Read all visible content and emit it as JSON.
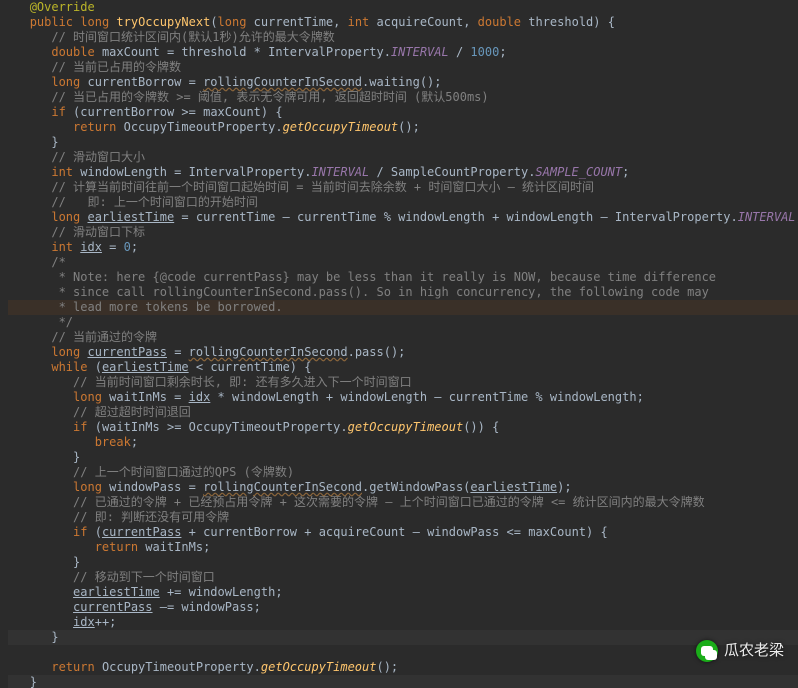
{
  "watermark": "瓜农老梁",
  "lines": [
    {
      "indent": 1,
      "parts": [
        {
          "t": "@Override",
          "c": "ann"
        }
      ]
    },
    {
      "indent": 1,
      "parts": [
        {
          "t": "public ",
          "c": "mod"
        },
        {
          "t": "long ",
          "c": "type"
        },
        {
          "t": "tryOccupyNext",
          "c": "methodDef"
        },
        {
          "t": "(",
          "c": "p"
        },
        {
          "t": "long ",
          "c": "type"
        },
        {
          "t": "currentTime",
          "c": "decl"
        },
        {
          "t": ", ",
          "c": "p"
        },
        {
          "t": "int ",
          "c": "type"
        },
        {
          "t": "acquireCount",
          "c": "decl"
        },
        {
          "t": ", ",
          "c": "p"
        },
        {
          "t": "double ",
          "c": "type"
        },
        {
          "t": "threshold",
          "c": "decl"
        },
        {
          "t": ") {",
          "c": "brace"
        }
      ]
    },
    {
      "indent": 2,
      "parts": [
        {
          "t": "// 时间窗口统计区间内(默认1秒)允许的最大令牌数",
          "c": "cmt"
        }
      ]
    },
    {
      "indent": 2,
      "parts": [
        {
          "t": "double ",
          "c": "type"
        },
        {
          "t": "maxCount = threshold * IntervalProperty.",
          "c": "var"
        },
        {
          "t": "INTERVAL",
          "c": "const"
        },
        {
          "t": " / ",
          "c": "p"
        },
        {
          "t": "1000",
          "c": "num"
        },
        {
          "t": ";",
          "c": "p"
        }
      ]
    },
    {
      "indent": 2,
      "parts": [
        {
          "t": "// 当前已占用的令牌数",
          "c": "cmt"
        }
      ]
    },
    {
      "indent": 2,
      "parts": [
        {
          "t": "long ",
          "c": "type"
        },
        {
          "t": "currentBorrow = ",
          "c": "var"
        },
        {
          "t": "rollingCounterInSecond",
          "c": "warn"
        },
        {
          "t": ".waiting();",
          "c": "p"
        }
      ]
    },
    {
      "indent": 2,
      "parts": [
        {
          "t": "// 当已占用的令牌数 >= 阈值, 表示无令牌可用, 返回超时时间 (默认500ms)",
          "c": "cmt"
        }
      ]
    },
    {
      "indent": 2,
      "parts": [
        {
          "t": "if ",
          "c": "kw"
        },
        {
          "t": "(currentBorrow >= maxCount) {",
          "c": "p"
        }
      ]
    },
    {
      "indent": 3,
      "parts": [
        {
          "t": "return ",
          "c": "kw"
        },
        {
          "t": "OccupyTimeoutProperty.",
          "c": "var"
        },
        {
          "t": "getOccupyTimeout",
          "c": "italic"
        },
        {
          "t": "();",
          "c": "p"
        }
      ]
    },
    {
      "indent": 2,
      "parts": [
        {
          "t": "}",
          "c": "brace"
        }
      ]
    },
    {
      "indent": 2,
      "parts": [
        {
          "t": "// 滑动窗口大小",
          "c": "cmt"
        }
      ]
    },
    {
      "indent": 2,
      "parts": [
        {
          "t": "int ",
          "c": "type"
        },
        {
          "t": "windowLength = IntervalProperty.",
          "c": "var"
        },
        {
          "t": "INTERVAL",
          "c": "const"
        },
        {
          "t": " / SampleCountProperty.",
          "c": "var"
        },
        {
          "t": "SAMPLE_COUNT",
          "c": "const"
        },
        {
          "t": ";",
          "c": "p"
        }
      ]
    },
    {
      "indent": 2,
      "parts": [
        {
          "t": "// 计算当前时间往前一个时间窗口起始时间 = 当前时间去除余数 + 时间窗口大小 – 统计区间时间",
          "c": "cmt"
        }
      ]
    },
    {
      "indent": 2,
      "parts": [
        {
          "t": "//   即: 上一个时间窗口的开始时间",
          "c": "cmt"
        }
      ]
    },
    {
      "indent": 2,
      "parts": [
        {
          "t": "long ",
          "c": "type"
        },
        {
          "t": "earliestTime",
          "c": "mut"
        },
        {
          "t": " = currentTime – currentTime % windowLength + windowLength – IntervalProperty.",
          "c": "var"
        },
        {
          "t": "INTERVAL",
          "c": "const"
        },
        {
          "t": ";",
          "c": "p"
        }
      ]
    },
    {
      "indent": 2,
      "parts": [
        {
          "t": "// 滑动窗口下标",
          "c": "cmt"
        }
      ]
    },
    {
      "indent": 2,
      "parts": [
        {
          "t": "int ",
          "c": "type"
        },
        {
          "t": "idx",
          "c": "mut"
        },
        {
          "t": " = ",
          "c": "p"
        },
        {
          "t": "0",
          "c": "num"
        },
        {
          "t": ";",
          "c": "p"
        }
      ]
    },
    {
      "indent": 2,
      "parts": [
        {
          "t": "/*",
          "c": "cmt"
        }
      ]
    },
    {
      "indent": 2,
      "parts": [
        {
          "t": " * Note: here {@code currentPass} may be less than it really is NOW, because time difference",
          "c": "cmt"
        }
      ]
    },
    {
      "indent": 2,
      "parts": [
        {
          "t": " * since call rollingCounterInSecond.pass(). So in high concurrency, the following code may",
          "c": "cmt"
        }
      ]
    },
    {
      "indent": 2,
      "hl": "hl2",
      "parts": [
        {
          "t": " * lead more tokens be borrowed.",
          "c": "cmt"
        }
      ]
    },
    {
      "indent": 2,
      "parts": [
        {
          "t": " */",
          "c": "cmt"
        }
      ]
    },
    {
      "indent": 2,
      "parts": [
        {
          "t": "// 当前通过的令牌",
          "c": "cmt"
        }
      ]
    },
    {
      "indent": 2,
      "parts": [
        {
          "t": "long ",
          "c": "type"
        },
        {
          "t": "currentPass",
          "c": "mut"
        },
        {
          "t": " = ",
          "c": "p"
        },
        {
          "t": "rollingCounterInSecond",
          "c": "warn"
        },
        {
          "t": ".pass();",
          "c": "p"
        }
      ]
    },
    {
      "indent": 2,
      "parts": [
        {
          "t": "while ",
          "c": "kw"
        },
        {
          "t": "(",
          "c": "p"
        },
        {
          "t": "earliestTime",
          "c": "mut"
        },
        {
          "t": " < currentTime) ",
          "c": "p"
        },
        {
          "t": "{",
          "c": "brace"
        }
      ]
    },
    {
      "indent": 3,
      "parts": [
        {
          "t": "// 当前时间窗口剩余时长, 即: 还有多久进入下一个时间窗口",
          "c": "cmt"
        }
      ]
    },
    {
      "indent": 3,
      "parts": [
        {
          "t": "long ",
          "c": "type"
        },
        {
          "t": "waitInMs = ",
          "c": "var"
        },
        {
          "t": "idx",
          "c": "mut"
        },
        {
          "t": " * windowLength + windowLength – currentTime % windowLength;",
          "c": "p"
        }
      ]
    },
    {
      "indent": 3,
      "parts": [
        {
          "t": "// 超过超时时间退回",
          "c": "cmt"
        }
      ]
    },
    {
      "indent": 3,
      "parts": [
        {
          "t": "if ",
          "c": "kw"
        },
        {
          "t": "(waitInMs >= OccupyTimeoutProperty.",
          "c": "p"
        },
        {
          "t": "getOccupyTimeout",
          "c": "italic"
        },
        {
          "t": "()) {",
          "c": "p"
        }
      ]
    },
    {
      "indent": 4,
      "parts": [
        {
          "t": "break",
          "c": "kw"
        },
        {
          "t": ";",
          "c": "p"
        }
      ]
    },
    {
      "indent": 3,
      "parts": [
        {
          "t": "}",
          "c": "brace"
        }
      ]
    },
    {
      "indent": 3,
      "parts": [
        {
          "t": "// 上一个时间窗口通过的QPS (令牌数)",
          "c": "cmt"
        }
      ]
    },
    {
      "indent": 3,
      "parts": [
        {
          "t": "long ",
          "c": "type"
        },
        {
          "t": "windowPass = ",
          "c": "var"
        },
        {
          "t": "rollingCounterInSecond",
          "c": "warn"
        },
        {
          "t": ".getWindowPass(",
          "c": "p"
        },
        {
          "t": "earliestTime",
          "c": "mut"
        },
        {
          "t": ");",
          "c": "p"
        }
      ]
    },
    {
      "indent": 3,
      "parts": [
        {
          "t": "// 已通过的令牌 + 已经预占用令牌 + 这次需要的令牌 – 上个时间窗口已通过的令牌 <= 统计区间内的最大令牌数",
          "c": "cmt"
        }
      ]
    },
    {
      "indent": 3,
      "parts": [
        {
          "t": "// 即: 判断还没有可用令牌",
          "c": "cmt"
        }
      ]
    },
    {
      "indent": 3,
      "parts": [
        {
          "t": "if ",
          "c": "kw"
        },
        {
          "t": "(",
          "c": "p"
        },
        {
          "t": "currentPass",
          "c": "mut"
        },
        {
          "t": " + currentBorrow + acquireCount – windowPass <= maxCount) {",
          "c": "p"
        }
      ]
    },
    {
      "indent": 4,
      "parts": [
        {
          "t": "return ",
          "c": "kw"
        },
        {
          "t": "waitInMs;",
          "c": "p"
        }
      ]
    },
    {
      "indent": 3,
      "parts": [
        {
          "t": "}",
          "c": "brace"
        }
      ]
    },
    {
      "indent": 3,
      "parts": [
        {
          "t": "// 移动到下一个时间窗口",
          "c": "cmt"
        }
      ]
    },
    {
      "indent": 3,
      "parts": [
        {
          "t": "earliestTime",
          "c": "mut"
        },
        {
          "t": " += windowLength;",
          "c": "p"
        }
      ]
    },
    {
      "indent": 3,
      "parts": [
        {
          "t": "currentPass",
          "c": "mut"
        },
        {
          "t": " –= windowPass;",
          "c": "p"
        }
      ]
    },
    {
      "indent": 3,
      "parts": [
        {
          "t": "idx",
          "c": "mut"
        },
        {
          "t": "++;",
          "c": "p"
        }
      ]
    },
    {
      "indent": 2,
      "hl": "caret",
      "parts": [
        {
          "t": "}",
          "c": "brace"
        }
      ]
    },
    {
      "indent": 2,
      "parts": []
    },
    {
      "indent": 2,
      "parts": [
        {
          "t": "return ",
          "c": "kw"
        },
        {
          "t": "OccupyTimeoutProperty.",
          "c": "var"
        },
        {
          "t": "getOccupyTimeout",
          "c": "italic"
        },
        {
          "t": "();",
          "c": "p"
        }
      ]
    },
    {
      "indent": 1,
      "hl": "hl",
      "parts": [
        {
          "t": "}",
          "c": "brace"
        }
      ]
    }
  ]
}
